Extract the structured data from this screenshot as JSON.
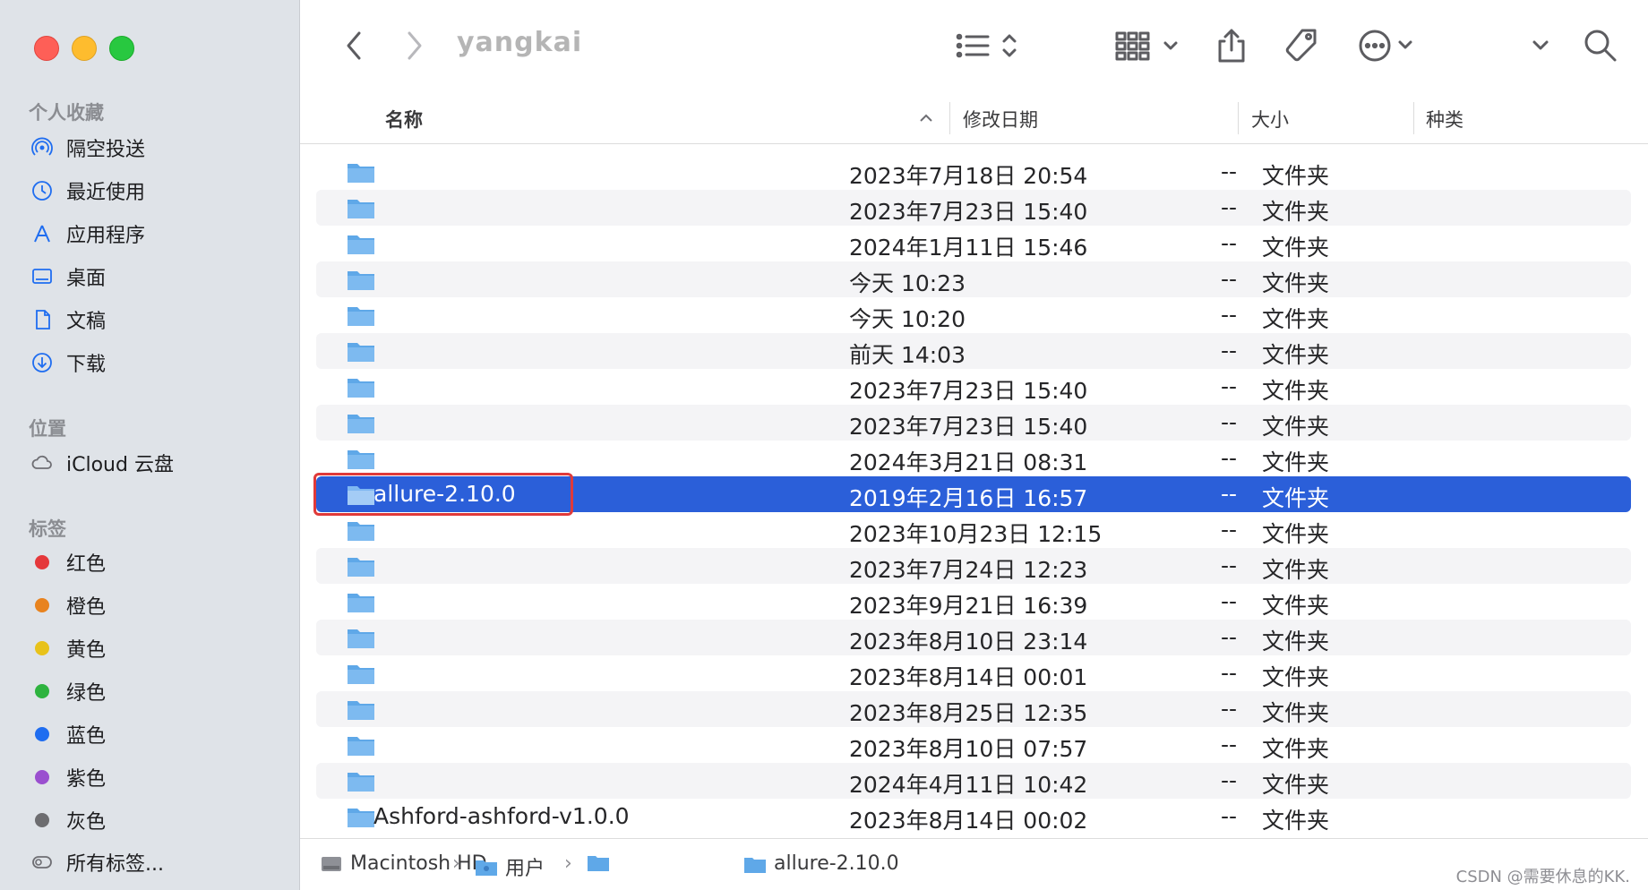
{
  "window_title": "yangkai",
  "sidebar": {
    "favorites_title": "个人收藏",
    "favorites": [
      {
        "label": "隔空投送",
        "icon": "airdrop-icon"
      },
      {
        "label": "最近使用",
        "icon": "clock-icon"
      },
      {
        "label": "应用程序",
        "icon": "apps-icon"
      },
      {
        "label": "桌面",
        "icon": "desktop-icon"
      },
      {
        "label": "文稿",
        "icon": "document-icon"
      },
      {
        "label": "下载",
        "icon": "download-icon"
      }
    ],
    "locations_title": "位置",
    "locations": [
      {
        "label": "iCloud 云盘",
        "icon": "cloud-icon"
      }
    ],
    "tags_title": "标签",
    "tags": [
      {
        "label": "红色",
        "color": "#e5383b"
      },
      {
        "label": "橙色",
        "color": "#e8831e"
      },
      {
        "label": "黄色",
        "color": "#e8c21a"
      },
      {
        "label": "绿色",
        "color": "#2eb33f"
      },
      {
        "label": "蓝色",
        "color": "#1f6df0"
      },
      {
        "label": "紫色",
        "color": "#9a4fcf"
      },
      {
        "label": "灰色",
        "color": "#6d6d70"
      }
    ],
    "all_tags": "所有标签..."
  },
  "columns": {
    "name": "名称",
    "date": "修改日期",
    "size": "大小",
    "kind": "种类"
  },
  "files": [
    {
      "name": "",
      "date": "2023年7月18日 20:54",
      "size": "--",
      "kind": "文件夹"
    },
    {
      "name": "",
      "date": "2023年7月23日 15:40",
      "size": "--",
      "kind": "文件夹"
    },
    {
      "name": "",
      "date": "2024年1月11日 15:46",
      "size": "--",
      "kind": "文件夹"
    },
    {
      "name": "",
      "date": "今天 10:23",
      "size": "--",
      "kind": "文件夹"
    },
    {
      "name": "",
      "date": "今天 10:20",
      "size": "--",
      "kind": "文件夹"
    },
    {
      "name": "",
      "date": "前天 14:03",
      "size": "--",
      "kind": "文件夹"
    },
    {
      "name": "",
      "date": "2023年7月23日 15:40",
      "size": "--",
      "kind": "文件夹"
    },
    {
      "name": "",
      "date": "2023年7月23日 15:40",
      "size": "--",
      "kind": "文件夹"
    },
    {
      "name": "",
      "date": "2024年3月21日 08:31",
      "size": "--",
      "kind": "文件夹"
    },
    {
      "name": "allure-2.10.0",
      "date": "2019年2月16日 16:57",
      "size": "--",
      "kind": "文件夹",
      "selected": true
    },
    {
      "name": "",
      "date": "2023年10月23日 12:15",
      "size": "--",
      "kind": "文件夹"
    },
    {
      "name": "",
      "date": "2023年7月24日 12:23",
      "size": "--",
      "kind": "文件夹"
    },
    {
      "name": "",
      "date": "2023年9月21日 16:39",
      "size": "--",
      "kind": "文件夹"
    },
    {
      "name": "",
      "date": "2023年8月10日 23:14",
      "size": "--",
      "kind": "文件夹"
    },
    {
      "name": "",
      "date": "2023年8月14日 00:01",
      "size": "--",
      "kind": "文件夹"
    },
    {
      "name": "",
      "date": "2023年8月25日 12:35",
      "size": "--",
      "kind": "文件夹"
    },
    {
      "name": "",
      "date": "2023年8月10日 07:57",
      "size": "--",
      "kind": "文件夹"
    },
    {
      "name": "",
      "date": "2024年4月11日 10:42",
      "size": "--",
      "kind": "文件夹"
    },
    {
      "name": "Ashford-ashford-v1.0.0",
      "date": "2023年8月14日 00:02",
      "size": "--",
      "kind": "文件夹"
    }
  ],
  "pathbar": {
    "items": [
      {
        "label": "Macintosh HD",
        "icon": "disk-icon"
      },
      {
        "label": "用户",
        "icon": "users-folder-icon"
      },
      {
        "label": "",
        "icon": "home-folder-icon"
      },
      {
        "label": "allure-2.10.0",
        "icon": "folder-icon"
      }
    ],
    "separator": "›"
  },
  "watermark": "CSDN @需要休息的KK."
}
